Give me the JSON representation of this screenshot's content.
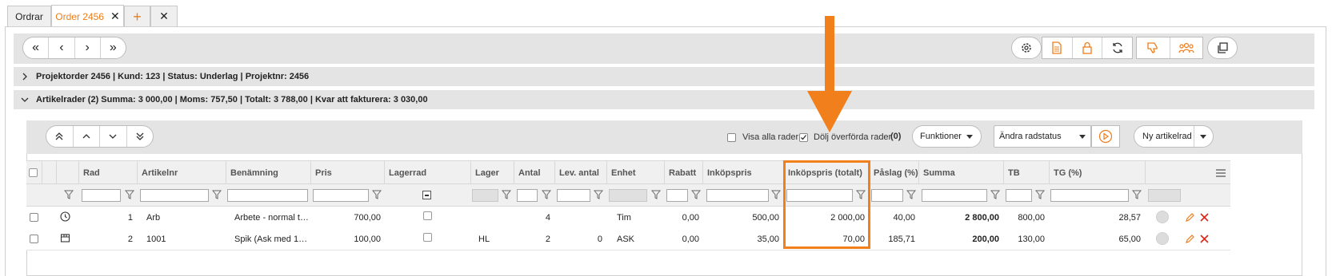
{
  "tabs": {
    "orders": "Ordrar",
    "order": "Order 2456",
    "close": "✕",
    "add": "+",
    "close_all": "✕"
  },
  "nav": {
    "first": "«",
    "prev": "‹",
    "next": "›",
    "last": "»"
  },
  "toolbar_icons": [
    "gear-icon",
    "document-icon",
    "lock-icon",
    "refresh-icon",
    "thumbs-down-icon",
    "users-icon",
    "copy-icon"
  ],
  "section1": {
    "text": "Projektorder 2456 | Kund: 123 | Status: Underlag | Projektnr: 2456"
  },
  "section2": {
    "text": "Artikelrader  (2) Summa: 3 000,00 | Moms: 757,50 | Totalt: 3 788,00 | Kvar att fakturera: 3 030,00"
  },
  "subtoolbar": {
    "show_all_rows": "Visa alla rader",
    "hide_transferred": "Dölj överförda rader",
    "hidden_count": "(0)",
    "functions": "Funktioner",
    "change_status": "Ändra radstatus",
    "new_row": "Ny artikelrad"
  },
  "columns": {
    "rad": "Rad",
    "artikelnr": "Artikelnr",
    "benamning": "Benämning",
    "pris": "Pris",
    "lagerrad": "Lagerrad",
    "lager": "Lager",
    "antal": "Antal",
    "lev_antal": "Lev. antal",
    "enhet": "Enhet",
    "rabatt": "Rabatt",
    "inkopspris": "Inköpspris",
    "inkopspris_totalt": "Inköpspris (totalt)",
    "paslag": "Påslag (%)",
    "summa": "Summa",
    "tb": "TB",
    "tg": "TG (%)"
  },
  "rows": [
    {
      "rad": "1",
      "artikelnr": "Arb",
      "benamning": "Arbete - normal t…",
      "pris": "700,00",
      "lager": "",
      "antal": "4",
      "lev_antal": "",
      "enhet": "Tim",
      "rabatt": "0,00",
      "inkopspris": "500,00",
      "inkopspris_totalt": "2 000,00",
      "paslag": "40,00",
      "summa": "2 800,00",
      "tb": "800,00",
      "tg": "28,57"
    },
    {
      "rad": "2",
      "artikelnr": "1001",
      "benamning": "Spik (Ask med 1…",
      "pris": "100,00",
      "lager": "HL",
      "antal": "2",
      "lev_antal": "0",
      "enhet": "ASK",
      "rabatt": "0,00",
      "inkopspris": "35,00",
      "inkopspris_totalt": "70,00",
      "paslag": "185,71",
      "summa": "200,00",
      "tb": "130,00",
      "tg": "65,00"
    }
  ],
  "colors": {
    "accent": "#ef7d1a",
    "highlight": "#f07f1c",
    "red": "#d9281c"
  }
}
